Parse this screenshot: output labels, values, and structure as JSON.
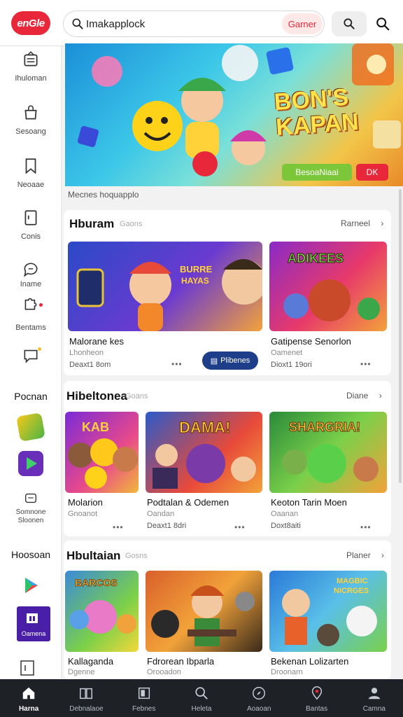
{
  "header": {
    "logo_text": "enGle",
    "search_value": "Imakapplock",
    "search_button": "Garner"
  },
  "sidebar": {
    "items": [
      {
        "label": "Ihuloman",
        "icon": "tray-icon"
      },
      {
        "label": "Sesoang",
        "icon": "bag-icon"
      },
      {
        "label": "Neoaae",
        "icon": "bookmark-icon"
      },
      {
        "label": "Conis",
        "icon": "document-icon"
      },
      {
        "label": "Iname",
        "icon": "chat-icon"
      },
      {
        "label": "Bentams",
        "icon": "puzzle-icon"
      }
    ],
    "group1_label": "Pocnan",
    "group1_apps": [
      {
        "label": "",
        "icon": "app-green-icon"
      },
      {
        "label": "",
        "icon": "play-icon"
      },
      {
        "label": "Somnone Sloonen",
        "icon": "store-icon"
      }
    ],
    "group2_label": "Hoosoan",
    "group2_apps": [
      {
        "label": "",
        "icon": "play-store-icon"
      },
      {
        "label": "Oamena",
        "icon": "media-app-icon"
      },
      {
        "label": "",
        "icon": "doc-app-icon"
      }
    ]
  },
  "hero": {
    "title_line1": "BON'S",
    "title_line2": "KAPAN",
    "button_primary": "BesoaNiaai",
    "button_secondary": "DK",
    "caption": "Mecnes hoquapplo"
  },
  "sections": [
    {
      "title": "Hburam",
      "subtitle": "Gaons",
      "more": "Rarneel",
      "games": [
        {
          "name": "Malorane kes",
          "sub": "Lhonheon",
          "meta": "Deaxt1 8om",
          "action": "Plibenes"
        },
        {
          "name": "Gatipense Senorlon",
          "sub": "Oamenet",
          "meta": "Dioxt1 19ori"
        }
      ]
    },
    {
      "title": "Hibeltonea",
      "subtitle": "Goans",
      "more": "Diane",
      "games": [
        {
          "name": "Molarion",
          "sub": "Gnoanot",
          "meta": ""
        },
        {
          "name": "Podtalan & Odemen",
          "sub": "Oandan",
          "meta": "Deaxt1 8dri"
        },
        {
          "name": "Keoton Tarin Moen",
          "sub": "Oaanan",
          "meta": "Doxt8aiti"
        }
      ]
    },
    {
      "title": "Hbultaian",
      "subtitle": "Gosns",
      "more": "Planer",
      "games": [
        {
          "name": "Kallaganda",
          "sub": "Dgenne",
          "meta": ""
        },
        {
          "name": "Fdrorean Ibparla",
          "sub": "Orooadon",
          "meta": ""
        },
        {
          "name": "Bekenan Lolizarten",
          "sub": "Droonarn",
          "meta": ""
        }
      ]
    }
  ],
  "bottom_nav": [
    {
      "label": "Harna",
      "icon": "home-icon",
      "active": true
    },
    {
      "label": "Debnalaoe",
      "icon": "book-icon",
      "active": false
    },
    {
      "label": "Febnes",
      "icon": "library-icon",
      "active": false
    },
    {
      "label": "Heleta",
      "icon": "search-icon",
      "active": false
    },
    {
      "label": "Aoaoan",
      "icon": "compass-icon",
      "active": false
    },
    {
      "label": "Bantas",
      "icon": "map-pin-icon",
      "active": false
    },
    {
      "label": "Camna",
      "icon": "profile-icon",
      "active": false
    }
  ],
  "colors": {
    "accent": "#e8283a",
    "nav_bg": "#1e2126",
    "badge_blue": "#1f3e8a"
  }
}
